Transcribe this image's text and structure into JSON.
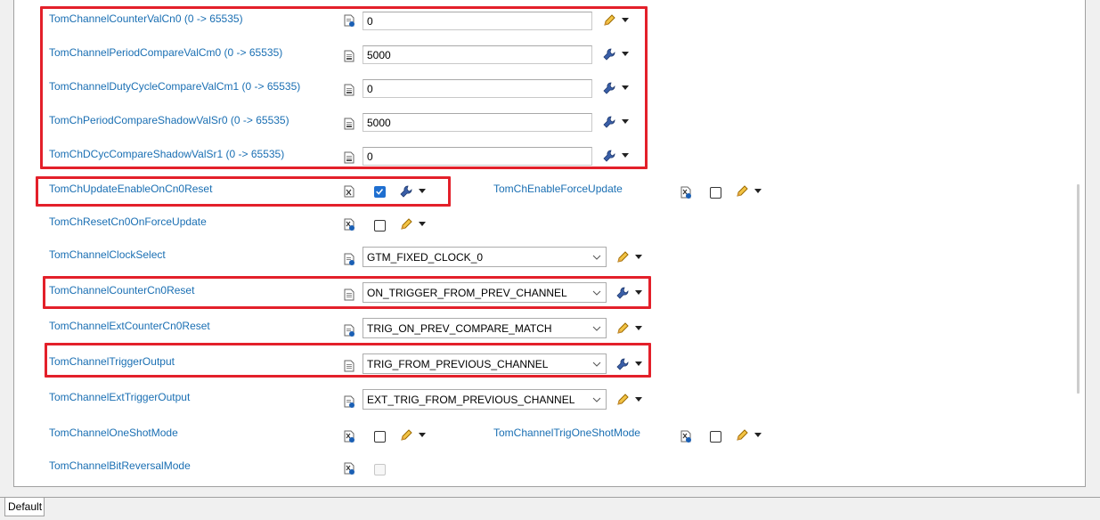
{
  "rows": [
    {
      "label": "TomChannelCounterValCn0 (0 -> 65535)",
      "value": "0"
    },
    {
      "label": "TomChannelPeriodCompareValCm0 (0 -> 65535)",
      "value": "5000"
    },
    {
      "label": "TomChannelDutyCycleCompareValCm1 (0 -> 65535)",
      "value": "0"
    },
    {
      "label": "TomChPeriodCompareShadowValSr0 (0 -> 65535)",
      "value": "5000"
    },
    {
      "label": "TomChDCycCompareShadowValSr1 (0 -> 65535)",
      "value": "0"
    }
  ],
  "checkboxes": {
    "update_enable": {
      "label": "TomChUpdateEnableOnCn0Reset",
      "checked": true
    },
    "enable_force_update": {
      "label": "TomChEnableForceUpdate",
      "checked": false
    },
    "reset_cn0_on_force": {
      "label": "TomChResetCn0OnForceUpdate",
      "checked": false
    },
    "one_shot": {
      "label": "TomChannelOneShotMode",
      "checked": false
    },
    "trig_one_shot": {
      "label": "TomChannelTrigOneShotMode",
      "checked": false
    },
    "bit_reversal": {
      "label": "TomChannelBitReversalMode",
      "checked": false
    }
  },
  "selects": [
    {
      "label": "TomChannelClockSelect",
      "value": "GTM_FIXED_CLOCK_0"
    },
    {
      "label": "TomChannelCounterCn0Reset",
      "value": "ON_TRIGGER_FROM_PREV_CHANNEL"
    },
    {
      "label": "TomChannelExtCounterCn0Reset",
      "value": "TRIG_ON_PREV_COMPARE_MATCH"
    },
    {
      "label": "TomChannelTriggerOutput",
      "value": "TRIG_FROM_PREVIOUS_CHANNEL"
    },
    {
      "label": "TomChannelExtTriggerOutput",
      "value": "EXT_TRIG_FROM_PREVIOUS_CHANNEL"
    }
  ],
  "tabs": {
    "default": "Default"
  },
  "colors": {
    "label": "#1a6fb3",
    "highlight": "#e3202a",
    "checked": "#1f6fd0"
  }
}
